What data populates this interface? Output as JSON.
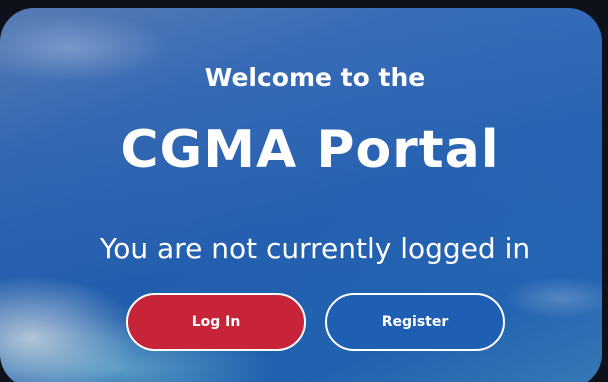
{
  "welcome": {
    "line1": "Welcome to the",
    "title": "CGMA Portal",
    "status": "You are not currently logged in"
  },
  "actions": {
    "login_label": "Log In",
    "register_label": "Register"
  },
  "colors": {
    "login_button": "#c7243a",
    "register_button": "#1f5fb3",
    "text": "#ffffff"
  }
}
